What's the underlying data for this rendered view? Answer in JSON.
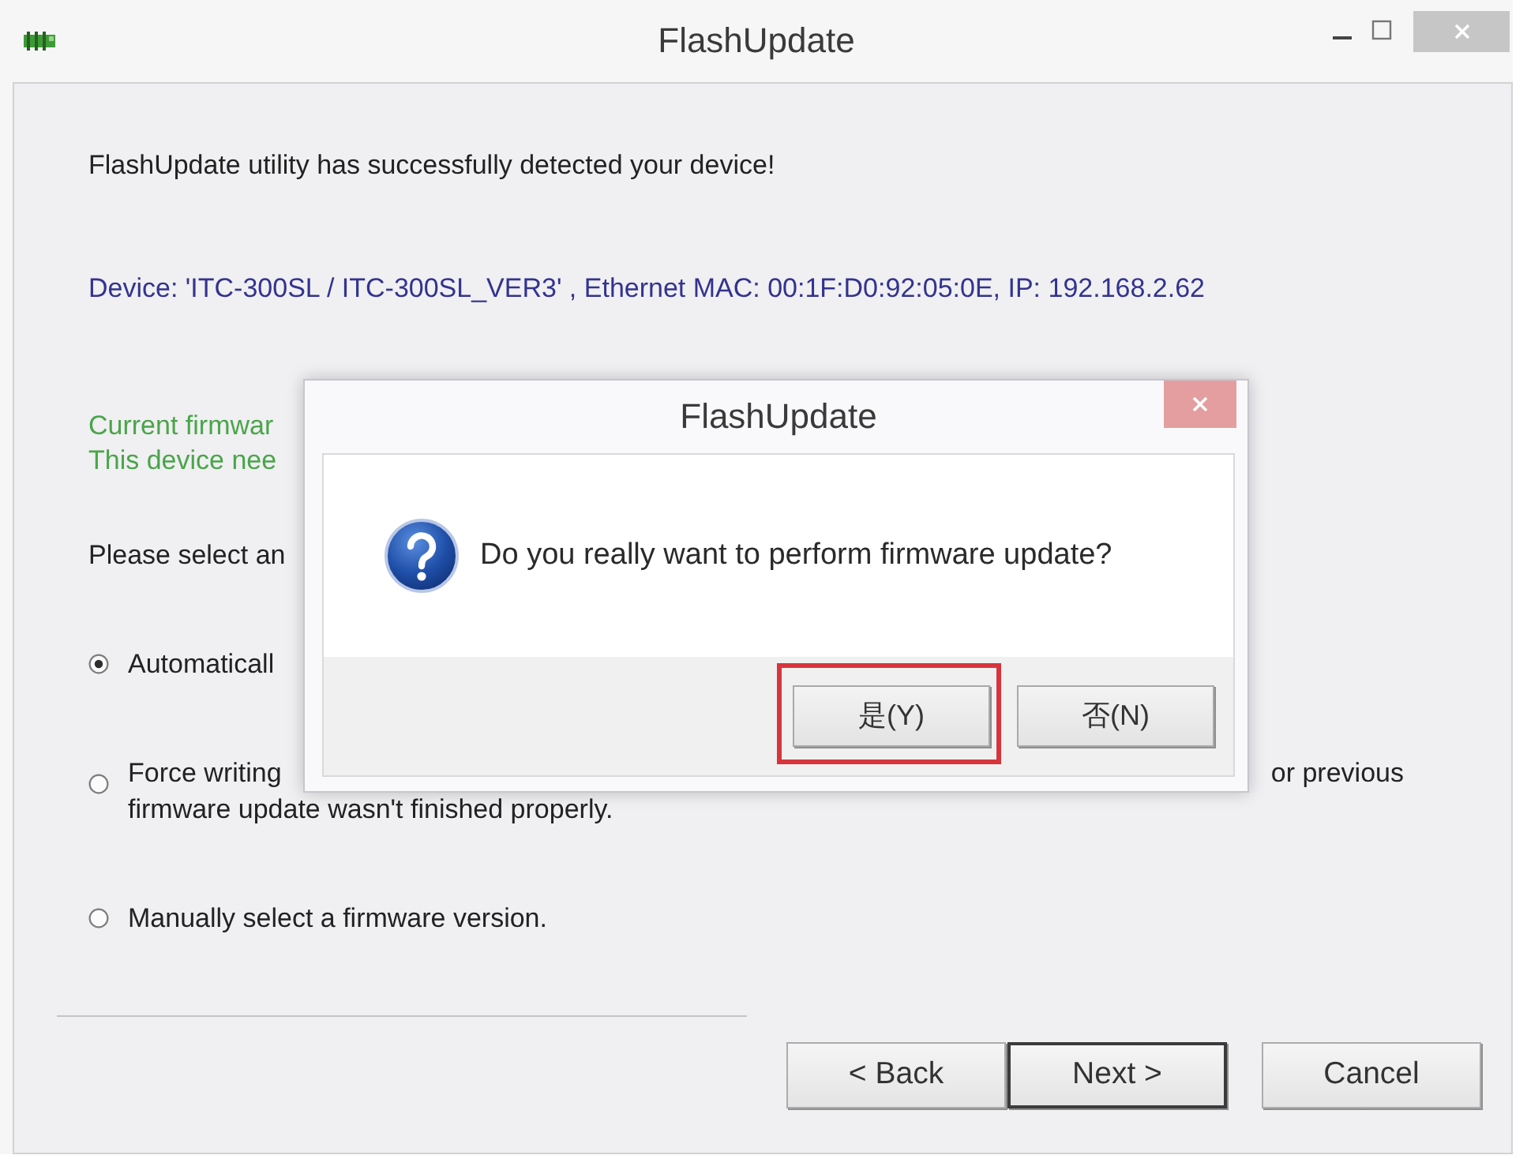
{
  "window": {
    "title": "FlashUpdate"
  },
  "intro": "FlashUpdate utility has successfully detected your device!",
  "device_info": "Device: 'ITC-300SL / ITC-300SL_VER3' , Ethernet MAC: 00:1F:D0:92:05:0E, IP: 192.168.2.62",
  "firmware_status": [
    "Current firmwar",
    "This device nee"
  ],
  "prompt": "Please select an",
  "options": [
    {
      "selected": true,
      "lines": [
        [
          "Automaticall"
        ]
      ]
    },
    {
      "selected": false,
      "lines": [
        [
          "Force writing",
          "or previous"
        ],
        [
          "firmware update wasn't finished properly."
        ]
      ]
    },
    {
      "selected": false,
      "lines": [
        [
          "Manually select a firmware version."
        ]
      ]
    }
  ],
  "buttons": [
    {
      "label": "< Back",
      "default": false
    },
    {
      "label": "Next >",
      "default": true
    },
    {
      "label": "Cancel",
      "default": false
    }
  ],
  "dialog": {
    "title": "FlashUpdate",
    "message": "Do you really want to perform firmware update?",
    "buttons": [
      {
        "label": "是(Y)",
        "highlighted": true
      },
      {
        "label": "否(N)",
        "highlighted": false
      }
    ]
  }
}
